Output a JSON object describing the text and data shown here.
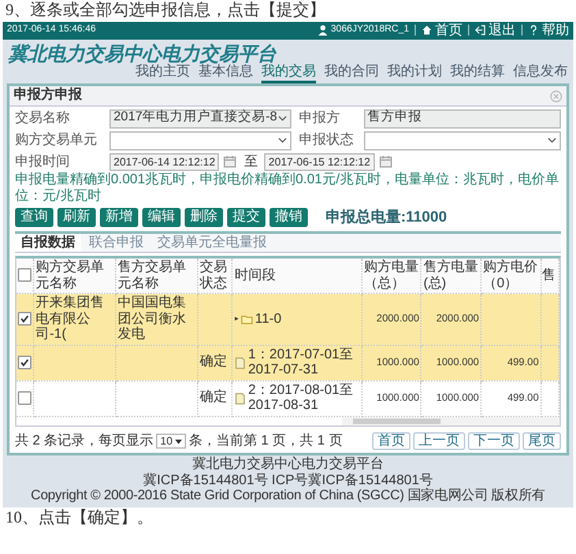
{
  "instruction_top": "9、逐条或全部勾选申报信息，点击【提交】",
  "top_bar": {
    "datetime": "2017-06-14 15:46:46",
    "user": "3066JY2018RC_1",
    "links": [
      {
        "label": "首页",
        "kind": "home"
      },
      {
        "label": "退出",
        "kind": "exit"
      },
      {
        "label": "帮助",
        "kind": "help"
      }
    ]
  },
  "site_title": "冀北电力交易中心电力交易平台",
  "nav": [
    {
      "label": "我的主页",
      "selected": false
    },
    {
      "label": "基本信息",
      "selected": false
    },
    {
      "label": "我的交易",
      "selected": true
    },
    {
      "label": "我的合同",
      "selected": false
    },
    {
      "label": "我的计划",
      "selected": false
    },
    {
      "label": "我的结算",
      "selected": false
    },
    {
      "label": "信息发布",
      "selected": false
    }
  ],
  "dialog": {
    "title": "申报方申报",
    "form": [
      {
        "label": "交易名称",
        "kind": "select",
        "value": "2017年电力用户直接交易-8",
        "disabled": true
      },
      {
        "label": "申报方",
        "kind": "text",
        "value": "售方申报",
        "disabled": true
      },
      {
        "label": "购方交易单元",
        "kind": "select",
        "disabled": false
      },
      {
        "label": "申报状态",
        "kind": "select",
        "disabled": false
      }
    ],
    "date_range": {
      "label": "申报时间",
      "from": "2017-06-14 12:12:12",
      "separator": "至",
      "to": "2017-06-15 12:12:12"
    },
    "note": "申报电量精确到0.001兆瓦时，申报电价精确到0.01元/兆瓦时，电量单位：兆瓦时，电价单位：元/兆瓦时",
    "buttons": [
      "查询",
      "刷新",
      "新增",
      "编辑",
      "删除",
      "提交",
      "撤销"
    ],
    "total": "申报总电量:11000",
    "tabs": [
      {
        "label": "自报数据",
        "selected": true
      },
      {
        "label": "联合申报",
        "selected": false
      },
      {
        "label": "交易单元全电量报",
        "selected": false
      }
    ],
    "table": {
      "all_checked": false,
      "columns": [
        "购方交易单元名称",
        "售方交易单元名称",
        "交易状态",
        "时间段",
        "购方电量（总）",
        "售方电量(总)",
        "购方电价（0）",
        "售"
      ],
      "rows": [
        {
          "kind": "group",
          "checked": true,
          "cells": [
            "开来集团售电有限公司-1(",
            "中国国电集团公司衡水发电",
            "",
            "11-0",
            "2000.000",
            "2000.000",
            ""
          ]
        },
        {
          "kind": "item",
          "checked": true,
          "cells": [
            "",
            "",
            "确定",
            "1：2017-07-01至2017-07-31",
            "1000.000",
            "1000.000",
            "499.00"
          ]
        },
        {
          "kind": "item",
          "checked": false,
          "cells": [
            "",
            "",
            "确定",
            "2：2017-08-01至2017-08-31",
            "1000.000",
            "1000.000",
            "499.00"
          ]
        }
      ]
    },
    "pager": {
      "summary_before": "共 2 条记录，每页显示",
      "page_size": "10",
      "summary_after": "条，当前第 1 页，共 1 页",
      "buttons": [
        "首页",
        "上一页",
        "下一页",
        "尾页"
      ]
    }
  },
  "footer": [
    "冀北电力交易中心电力交易平台",
    "冀ICP备15144801号 ICP号冀ICP备15144801号",
    "Copyright © 2000-2016 State Grid Corporation of China (SGCC) 国家电网公司 版权所有"
  ],
  "instruction_bottom": "10、点击【确定】。"
}
